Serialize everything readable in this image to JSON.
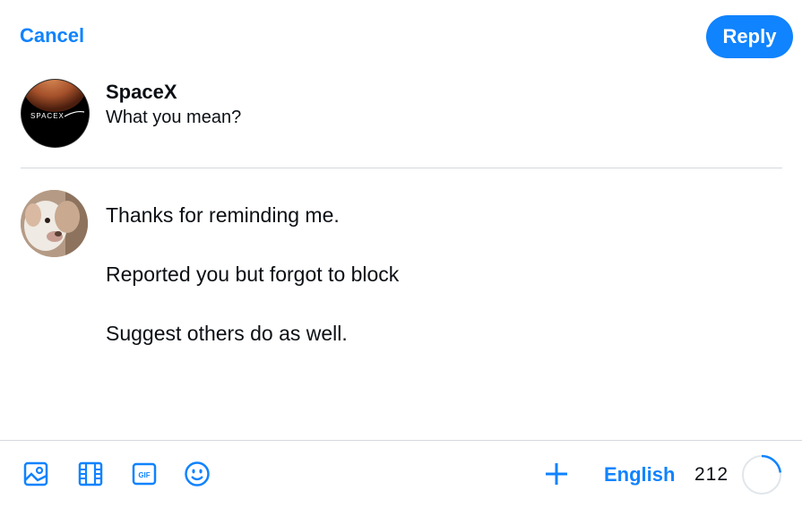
{
  "header": {
    "cancel_label": "Cancel",
    "reply_label": "Reply"
  },
  "parent_post": {
    "author": "SpaceX",
    "text": "What you mean?",
    "avatar": "spacex-logo-avatar",
    "avatar_logo_text": "SPACEX"
  },
  "draft": {
    "avatar": "dog-avatar",
    "lines": [
      "Thanks for reminding me.",
      "Reported you but forgot to block",
      "Suggest others do as well."
    ]
  },
  "toolbar": {
    "icons": [
      "image-icon",
      "video-icon",
      "gif-icon",
      "emoji-icon",
      "plus-icon"
    ],
    "gif_text": "GIF",
    "language": "English",
    "char_count": "212",
    "char_progress": 0.23
  },
  "colors": {
    "accent": "#1083fe",
    "divider": "#d4d9de",
    "text": "#0b0f14"
  }
}
